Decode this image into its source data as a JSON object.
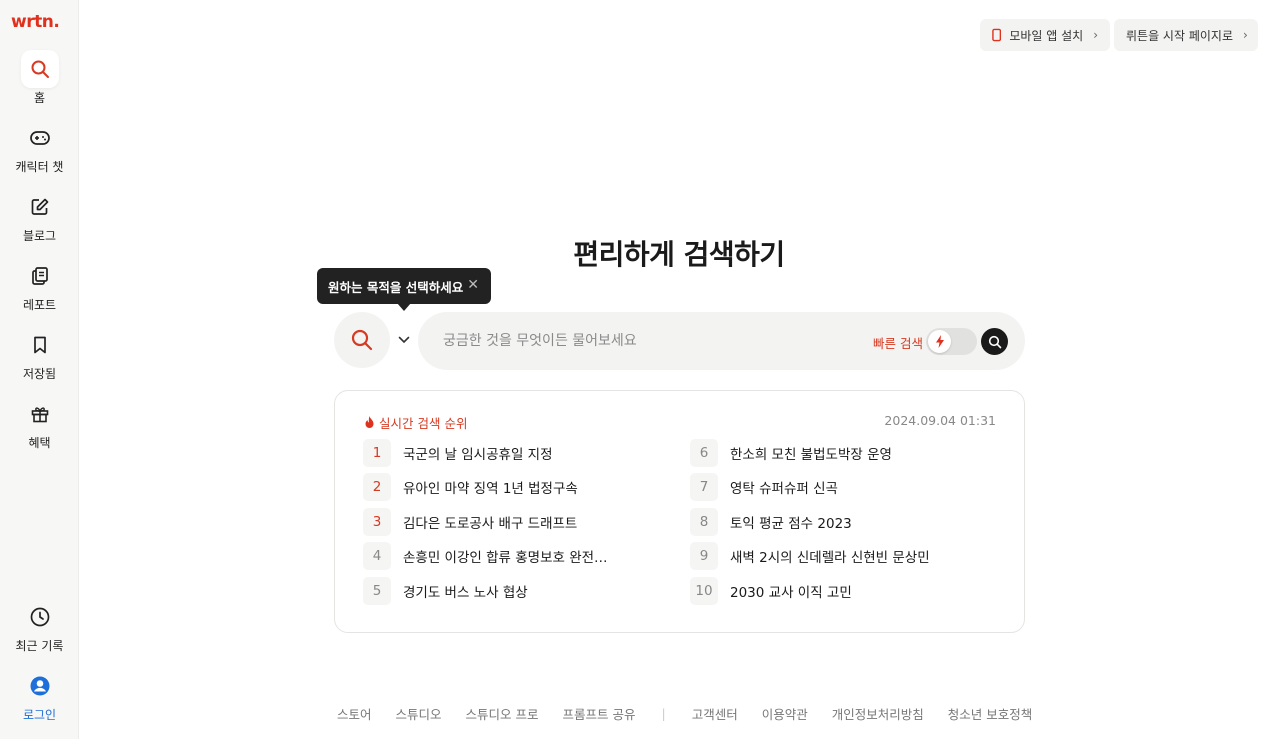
{
  "brand": {
    "logo": "wrtn."
  },
  "sidebar": {
    "items": [
      {
        "label": "홈",
        "icon": "search-icon"
      },
      {
        "label": "캐릭터 챗",
        "icon": "gamepad-icon"
      },
      {
        "label": "블로그",
        "icon": "edit-icon"
      },
      {
        "label": "레포트",
        "icon": "report-icon"
      },
      {
        "label": "저장됨",
        "icon": "bookmark-icon"
      },
      {
        "label": "혜택",
        "icon": "gift-icon"
      }
    ],
    "bottom": [
      {
        "label": "최근 기록",
        "icon": "clock-icon"
      },
      {
        "label": "로그인",
        "icon": "user-icon"
      }
    ]
  },
  "topbar": {
    "mobile_app": "모바일 앱 설치",
    "start_page": "뤼튼을 시작 페이지로"
  },
  "main": {
    "headline": "편리하게 검색하기",
    "tooltip": "원하는 목적을 선택하세요",
    "search_placeholder": "궁금한 것을 무엇이든 물어보세요",
    "quick_search_label": "빠른 검색"
  },
  "trending": {
    "title": "실시간 검색 순위",
    "timestamp": "2024.09.04 01:31",
    "items": [
      {
        "rank": "1",
        "text": "국군의 날 임시공휴일 지정"
      },
      {
        "rank": "2",
        "text": "유아인 마약 징역 1년 법정구속"
      },
      {
        "rank": "3",
        "text": "김다은 도로공사 배구 드래프트"
      },
      {
        "rank": "4",
        "text": "손흥민 이강인 합류 홍명보호 완전체 …"
      },
      {
        "rank": "5",
        "text": "경기도 버스 노사 협상"
      },
      {
        "rank": "6",
        "text": "한소희 모친 불법도박장 운영"
      },
      {
        "rank": "7",
        "text": "영탁 슈퍼슈퍼 신곡"
      },
      {
        "rank": "8",
        "text": "토익 평균 점수 2023"
      },
      {
        "rank": "9",
        "text": "새벽 2시의 신데렐라 신현빈 문상민"
      },
      {
        "rank": "10",
        "text": "2030 교사 이직 고민"
      }
    ]
  },
  "footer": {
    "links_left": [
      "스토어",
      "스튜디오",
      "스튜디오 프로",
      "프롬프트 공유"
    ],
    "links_right": [
      "고객센터",
      "이용약관",
      "개인정보처리방침",
      "청소년 보호정책"
    ],
    "divider": "|"
  },
  "colors": {
    "brand": "#e0301e",
    "accent_red": "#d63a22",
    "login_blue": "#1e6fd9"
  }
}
